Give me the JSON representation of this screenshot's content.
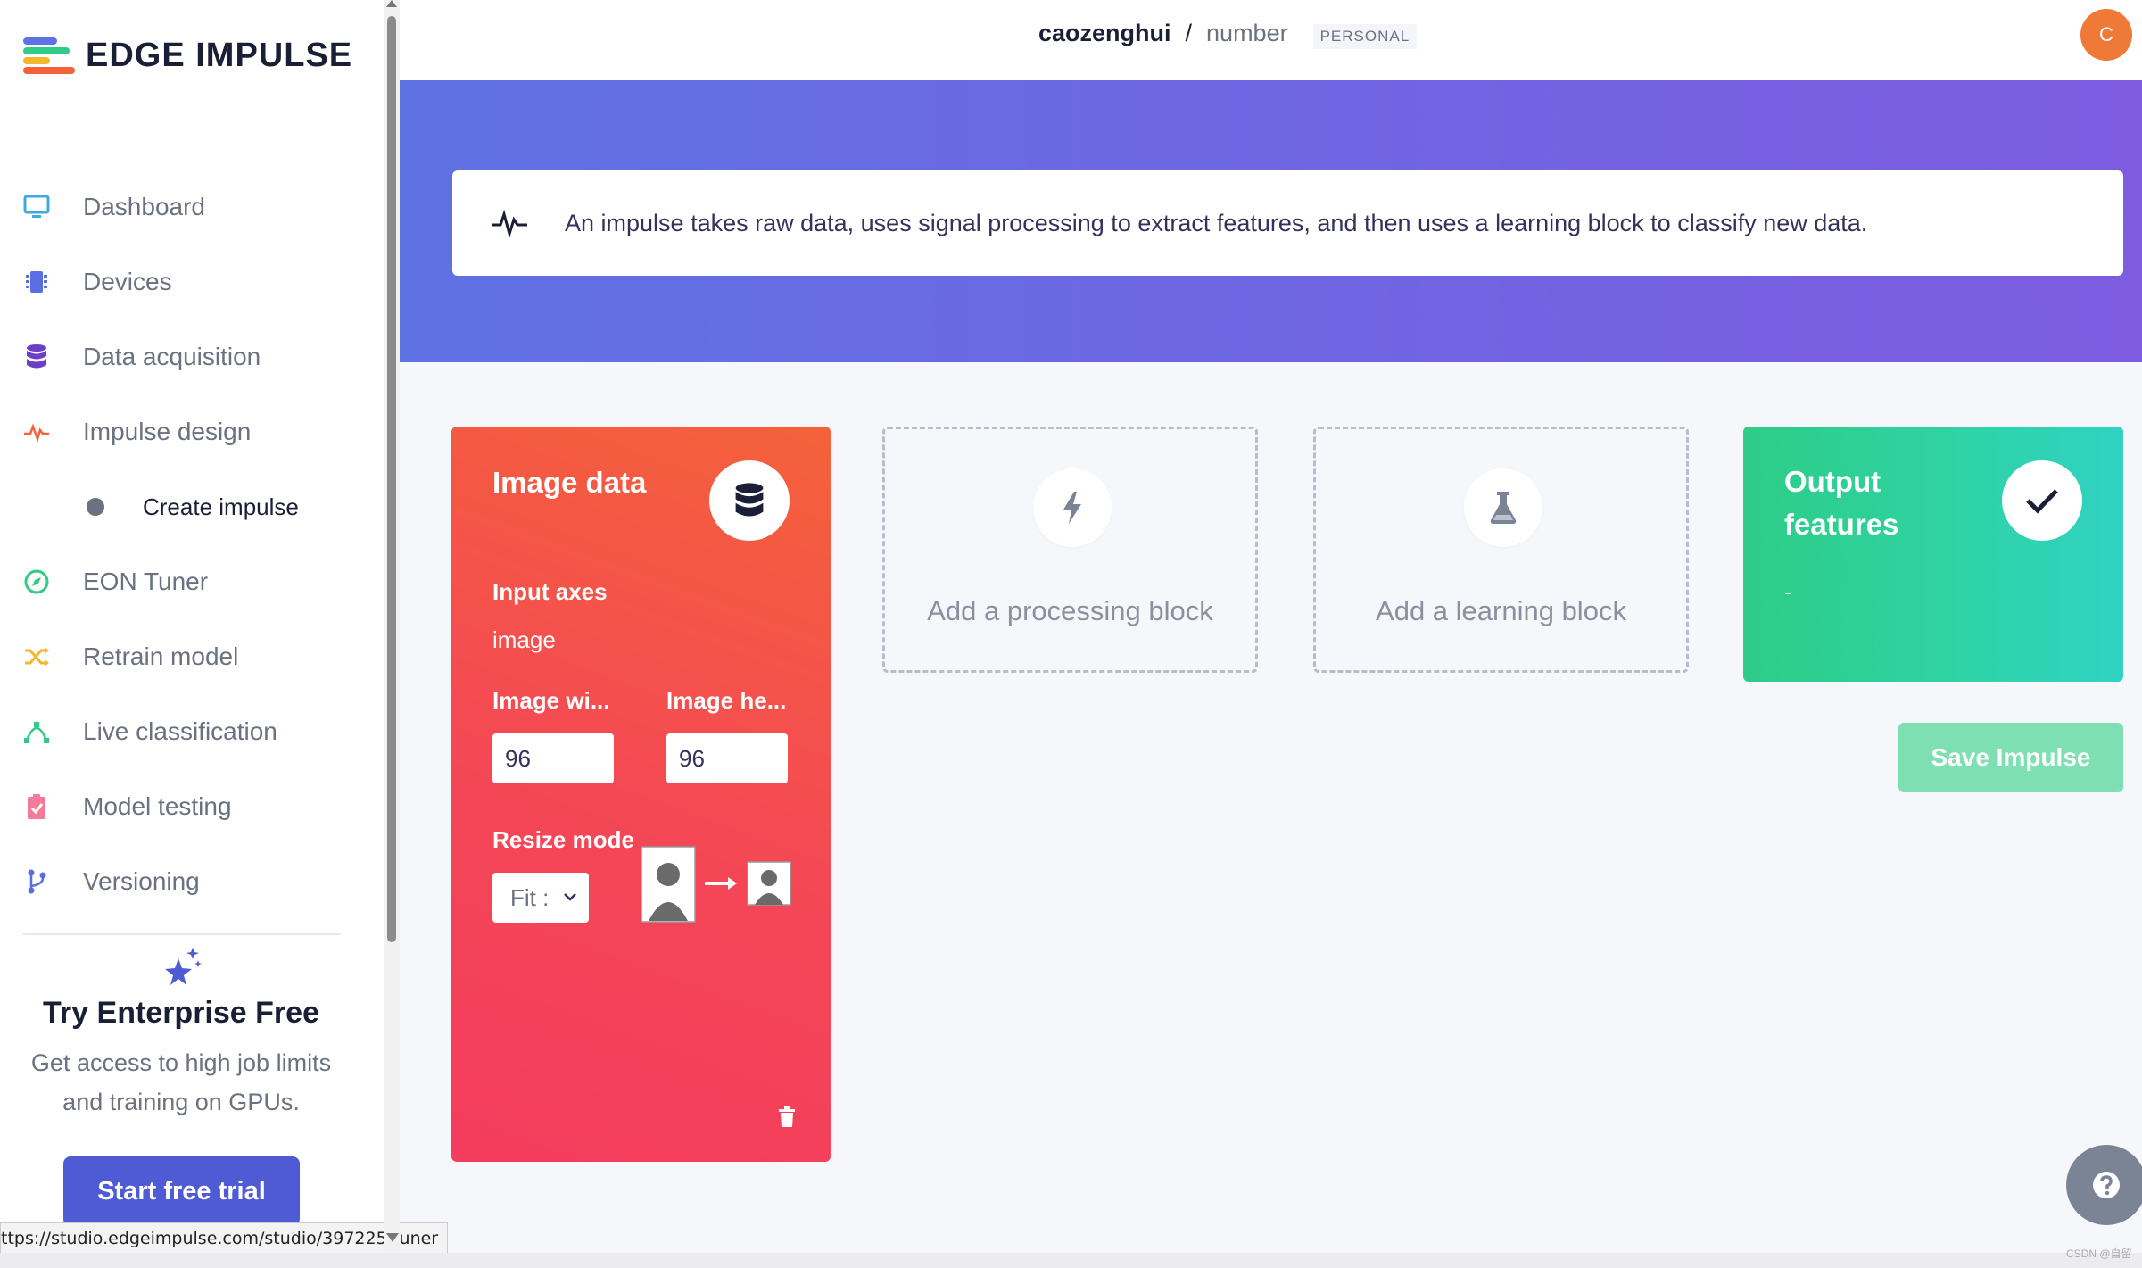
{
  "app": {
    "logo_text": "EDGE IMPULSE",
    "brand_colors": [
      "#4f5bd5",
      "#ef7a38",
      "#2ecc87",
      "#f44756"
    ]
  },
  "sidebar": {
    "items": [
      {
        "label": "Dashboard",
        "icon": "monitor-icon",
        "color": "#3fa9e0"
      },
      {
        "label": "Devices",
        "icon": "chip-icon",
        "color": "#5b6ee1"
      },
      {
        "label": "Data acquisition",
        "icon": "database-icon",
        "color": "#6b3fc9"
      },
      {
        "label": "Impulse design",
        "icon": "pulse-icon",
        "color": "#f4623a"
      },
      {
        "label": "Create impulse",
        "icon": "dot-icon",
        "sub": true
      },
      {
        "label": "EON Tuner",
        "icon": "compass-icon",
        "color": "#2ecc87"
      },
      {
        "label": "Retrain model",
        "icon": "shuffle-icon",
        "color": "#f4b62c"
      },
      {
        "label": "Live classification",
        "icon": "nodes-icon",
        "color": "#2ecc87"
      },
      {
        "label": "Model testing",
        "icon": "clipboard-check-icon",
        "color": "#f47c9a"
      },
      {
        "label": "Versioning",
        "icon": "branch-icon",
        "color": "#5b6ee1"
      }
    ],
    "enterprise": {
      "title": "Try Enterprise Free",
      "desc_line1": "Get access to high job limits",
      "desc_line2": "and training on GPUs.",
      "button": "Start free trial"
    },
    "status_url": "ttps://studio.edgeimpulse.com/studio/397225/tuner"
  },
  "topbar": {
    "user": "caozenghui",
    "separator": "/",
    "project": "number",
    "badge": "PERSONAL",
    "avatar_initial": "C"
  },
  "banner": {
    "info": "An impulse takes raw data, uses signal processing to extract features, and then uses a learning block to classify new data."
  },
  "blocks": {
    "image": {
      "title": "Image data",
      "input_axes_label": "Input axes",
      "input_axes_value": "image",
      "width_label": "Image wi...",
      "height_label": "Image he...",
      "width_value": "96",
      "height_value": "96",
      "resize_label": "Resize mode",
      "resize_value": "Fit :"
    },
    "processing": {
      "label": "Add a processing block"
    },
    "learning": {
      "label": "Add a learning block"
    },
    "output": {
      "title": "Output features",
      "value": "-"
    },
    "save_button": "Save Impulse"
  },
  "footer": {
    "watermark": "CSDN @自留"
  }
}
